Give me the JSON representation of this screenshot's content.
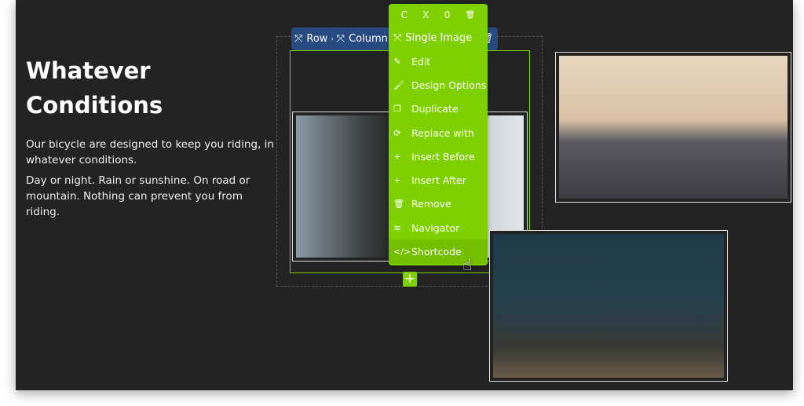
{
  "content": {
    "heading": "Whatever Conditions",
    "paragraph1": "Our bicycle are designed to keep you riding, in whatever conditions.",
    "paragraph2": "Day or night. Rain or sunshine. On road or mountain. Nothing can prevent you from riding."
  },
  "toolbar": {
    "row": "Row",
    "column": "Column",
    "single_image": "Single Image"
  },
  "menu_top": {
    "c": "C",
    "x": "X",
    "zero": "0"
  },
  "menu": [
    {
      "label": "Edit",
      "icon": "pencil-icon",
      "glyph": "✎"
    },
    {
      "label": "Design Options",
      "icon": "brush-icon",
      "glyph": "🖌"
    },
    {
      "label": "Duplicate",
      "icon": "duplicate-icon",
      "glyph": "❐"
    },
    {
      "label": "Replace with",
      "icon": "refresh-icon",
      "glyph": "⟳"
    },
    {
      "label": "Insert Before",
      "icon": "plus-icon",
      "glyph": "+"
    },
    {
      "label": "Insert After",
      "icon": "plus-icon",
      "glyph": "+"
    },
    {
      "label": "Remove",
      "icon": "trash-icon",
      "glyph": "🗑"
    },
    {
      "label": "Navigator",
      "icon": "layers-icon",
      "glyph": "≋"
    },
    {
      "label": "Shortcode",
      "icon": "code-icon",
      "glyph": "</>"
    }
  ],
  "colors": {
    "accent": "#7fd000",
    "toolbar": "#274a80",
    "background": "#232323"
  }
}
